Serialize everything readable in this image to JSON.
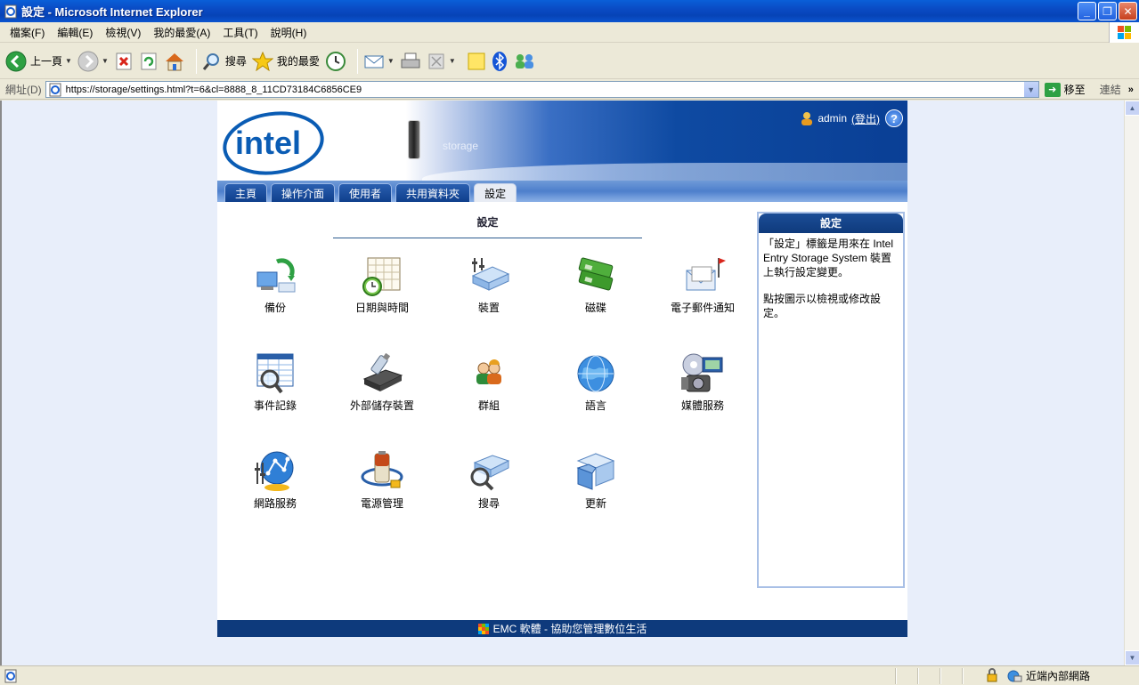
{
  "window": {
    "title": "設定 - Microsoft Internet Explorer"
  },
  "menu": [
    "檔案(F)",
    "編輯(E)",
    "檢視(V)",
    "我的最愛(A)",
    "工具(T)",
    "說明(H)"
  ],
  "toolbar": {
    "back_label": "上一頁",
    "search_label": "搜尋",
    "favorites_label": "我的最愛"
  },
  "address": {
    "label": "網址(D)",
    "url": "https://storage/settings.html?t=6&cl=8888_8_11CD73184C6856CE9",
    "go_label": "移至",
    "links_label": "連結"
  },
  "header": {
    "device_name": "storage",
    "user": "admin",
    "logout": "(登出)",
    "help": "?"
  },
  "nav": {
    "tabs": [
      "主頁",
      "操作介面",
      "使用者",
      "共用資料夾",
      "設定"
    ],
    "active_tab": "設定"
  },
  "main": {
    "title": "設定",
    "items": [
      {
        "label": "備份",
        "icon": "backup-icon"
      },
      {
        "label": "日期與時間",
        "icon": "calendar-clock-icon"
      },
      {
        "label": "裝置",
        "icon": "device-icon"
      },
      {
        "label": "磁碟",
        "icon": "disk-icon"
      },
      {
        "label": "電子郵件通知",
        "icon": "email-notification-icon"
      },
      {
        "label": "事件記錄",
        "icon": "event-log-icon"
      },
      {
        "label": "外部儲存裝置",
        "icon": "external-storage-icon"
      },
      {
        "label": "群組",
        "icon": "group-icon"
      },
      {
        "label": "語言",
        "icon": "globe-icon"
      },
      {
        "label": "媒體服務",
        "icon": "media-icon"
      },
      {
        "label": "網路服務",
        "icon": "network-icon"
      },
      {
        "label": "電源管理",
        "icon": "battery-icon"
      },
      {
        "label": "搜尋",
        "icon": "search-icon"
      },
      {
        "label": "更新",
        "icon": "update-icon"
      }
    ]
  },
  "sidebar": {
    "title": "設定",
    "para1": "「設定」標籤是用來在 Intel Entry Storage System 裝置上執行設定變更。",
    "para2": "點按圖示以檢視或修改設定。"
  },
  "footer": {
    "text": "EMC 軟體 - 協助您管理數位生活"
  },
  "status": {
    "zone": "近端內部網路"
  },
  "colors": {
    "titlebar": "#0a4bc4",
    "nav_dark": "#0e3a7c",
    "accent": "#2c5b8f"
  }
}
